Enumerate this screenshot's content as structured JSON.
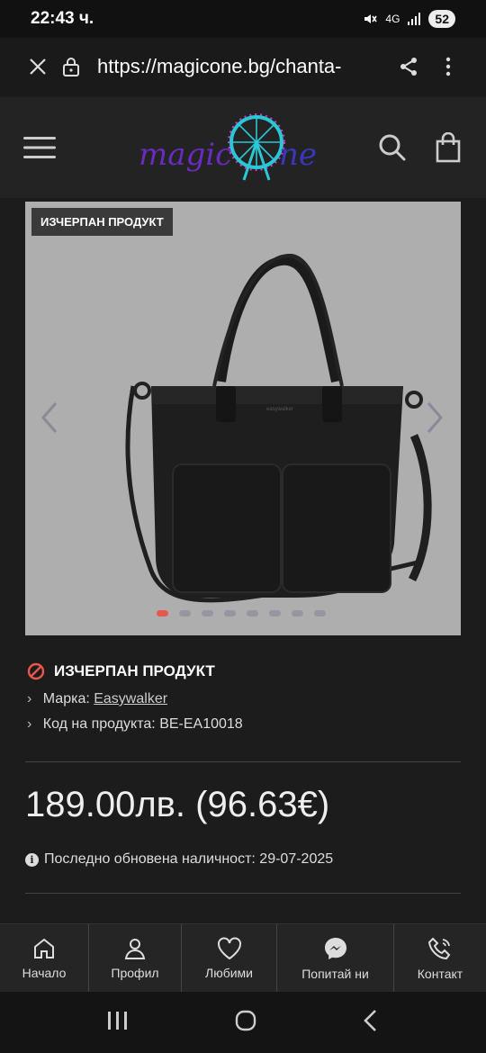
{
  "status_bar": {
    "time": "22:43 ч.",
    "network": "4G",
    "battery": "52"
  },
  "browser": {
    "url": "https://magicone.bg/chanta-"
  },
  "site": {
    "logo_text_left": "magic",
    "logo_text_right": "ne"
  },
  "product": {
    "badge": "ИЗЧЕРПАН ПРОДУКТ",
    "availability": "ИЗЧЕРПАН ПРОДУКТ",
    "brand_label": "Марка:",
    "brand_value": "Easywalker",
    "code_label": "Код на продукта:",
    "code_value": "BE-EA10018",
    "price": "189.00лв. (96.63€)",
    "updated_text": "Последно обновена наличност: 29-07-2025",
    "gallery_count": 8,
    "gallery_active": 1,
    "image_brand_mark": "easywalker"
  },
  "bottom_nav": {
    "home": "Начало",
    "profile": "Профил",
    "favorites": "Любими",
    "ask": "Попитай ни",
    "contact": "Контакт"
  },
  "colors": {
    "accent": "#e7574c",
    "background": "#1c1c1c",
    "header": "#232323",
    "logo_teal": "#2ac7d6",
    "logo_purple": "#7a2bc9"
  }
}
